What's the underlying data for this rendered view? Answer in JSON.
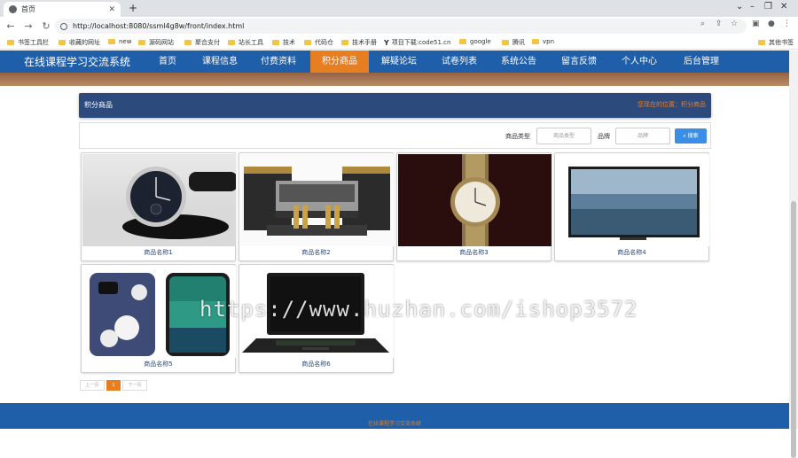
{
  "browser": {
    "tab_title": "首页",
    "url": "http://localhost:8080/ssml4g8w/front/index.html",
    "bookmarks": [
      "书签工具栏",
      "收藏的网址",
      "new",
      "源码网站",
      "聚合支付",
      "站长工具",
      "技术",
      "代码仓",
      "技术手册",
      "项目下载:code51.cn",
      "google",
      "腾讯",
      "vpn",
      "其他书签"
    ]
  },
  "site": {
    "name": "在线课程学习交流系统",
    "nav": [
      "首页",
      "课程信息",
      "付费资料",
      "积分商品",
      "解疑论坛",
      "试卷列表",
      "系统公告",
      "留言反馈",
      "个人中心",
      "后台管理"
    ],
    "active_nav": "积分商品"
  },
  "section": {
    "title": "积分商品",
    "location_label": "您现在的位置：积分商品"
  },
  "search": {
    "type_label": "商品类型",
    "type_placeholder": "商品类型",
    "brand_label": "品牌",
    "brand_placeholder": "品牌",
    "button": "搜索"
  },
  "products": [
    {
      "name": "商品名称1",
      "image": "watch-leather"
    },
    {
      "name": "商品名称2",
      "image": "audio-mixer-speakers"
    },
    {
      "name": "商品名称3",
      "image": "watch-gold"
    },
    {
      "name": "商品名称4",
      "image": "television"
    },
    {
      "name": "商品名称5",
      "image": "phones"
    },
    {
      "name": "商品名称6",
      "image": "laptop"
    }
  ],
  "pagination": {
    "prev": "上一页",
    "current": "1",
    "next": "下一页"
  },
  "footer": {
    "text": "在线课程学习交流系统"
  },
  "watermark": "https://www.huzhan.com/ishop3572",
  "colors": {
    "nav_bg": "#1f5fa9",
    "active": "#e67e22",
    "section_bg": "#2c4a7c",
    "search_btn": "#3a8ee6"
  }
}
